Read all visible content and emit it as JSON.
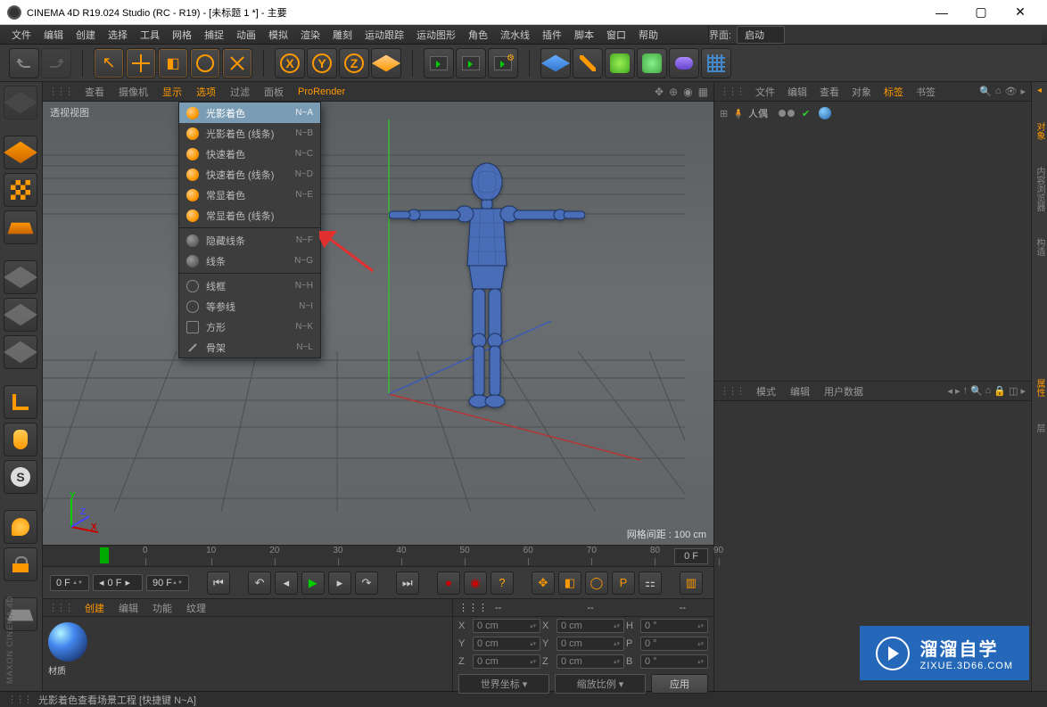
{
  "title": "CINEMA 4D R19.024 Studio (RC - R19) - [未标题 1 *] - 主要",
  "win_ctrls": {
    "min": "—",
    "max": "▢",
    "close": "✕"
  },
  "menubar": [
    "文件",
    "编辑",
    "创建",
    "选择",
    "工具",
    "网格",
    "捕捉",
    "动画",
    "模拟",
    "渲染",
    "雕刻",
    "运动跟踪",
    "运动图形",
    "角色",
    "流水线",
    "插件",
    "脚本",
    "窗口",
    "帮助"
  ],
  "layout_label": "界面:",
  "layout_value": "启动",
  "vp_tabs": [
    "查看",
    "摄像机",
    "显示",
    "选项",
    "过滤",
    "面板",
    "ProRender"
  ],
  "vp_sel_idx": 2,
  "vp_label": "透视视图",
  "grid_info": "网格间距 : 100 cm",
  "axes": {
    "x": "X",
    "y": "Y",
    "z": "Z"
  },
  "dropdown": [
    {
      "label": "光影着色",
      "sc": "N~A",
      "ico": "o",
      "sel": true
    },
    {
      "label": "光影着色 (线条)",
      "sc": "N~B",
      "ico": "o"
    },
    {
      "label": "快速着色",
      "sc": "N~C",
      "ico": "o"
    },
    {
      "label": "快速着色 (线条)",
      "sc": "N~D",
      "ico": "o"
    },
    {
      "label": "常显着色",
      "sc": "N~E",
      "ico": "o"
    },
    {
      "label": "常显着色 (线条)",
      "sc": "",
      "ico": "o"
    },
    {
      "sep": true
    },
    {
      "label": "隐藏线条",
      "sc": "N~F",
      "ico": "g"
    },
    {
      "label": "线条",
      "sc": "N~G",
      "ico": "g"
    },
    {
      "sep": true
    },
    {
      "label": "线框",
      "sc": "N~H",
      "ico": "w"
    },
    {
      "label": "等参线",
      "sc": "N~I",
      "ico": "w"
    },
    {
      "label": "方形",
      "sc": "N~K",
      "ico": "w"
    },
    {
      "label": "骨架",
      "sc": "N~L",
      "ico": "b"
    }
  ],
  "timeline": {
    "ticks": [
      0,
      10,
      20,
      30,
      40,
      50,
      60,
      70,
      80,
      90
    ],
    "end": "0 F"
  },
  "playback": {
    "start": "0 F",
    "cur": "0 F",
    "end": "90 F"
  },
  "mat_tabs": [
    "创建",
    "编辑",
    "功能",
    "纹理"
  ],
  "mat_label": "材质",
  "coord": {
    "dash": "--",
    "rows": [
      {
        "l1": "X",
        "v1": "0 cm",
        "l2": "X",
        "v2": "0 cm",
        "l3": "H",
        "v3": "0 °"
      },
      {
        "l1": "Y",
        "v1": "0 cm",
        "l2": "Y",
        "v2": "0 cm",
        "l3": "P",
        "v3": "0 °"
      },
      {
        "l1": "Z",
        "v1": "0 cm",
        "l2": "Z",
        "v2": "0 cm",
        "l3": "B",
        "v3": "0 °"
      }
    ],
    "dd1": "世界坐标",
    "dd2": "缩放比例",
    "apply": "应用"
  },
  "obj_tabs": [
    "文件",
    "编辑",
    "查看",
    "对象",
    "标签",
    "书签"
  ],
  "obj_sel_idx": 4,
  "obj_item": "人偶",
  "attr_tabs": [
    "模式",
    "编辑",
    "用户数据"
  ],
  "side_tabs": [
    "对象",
    "内容浏览器",
    "构造"
  ],
  "side_tabs2": [
    "属性",
    "层"
  ],
  "status": "光影着色查看场景工程 [快捷键 N~A]",
  "maxon": "MAXON CINEMA 4D",
  "wm": {
    "t1": "溜溜自学",
    "t2": "ZIXUE.3D66.COM"
  }
}
